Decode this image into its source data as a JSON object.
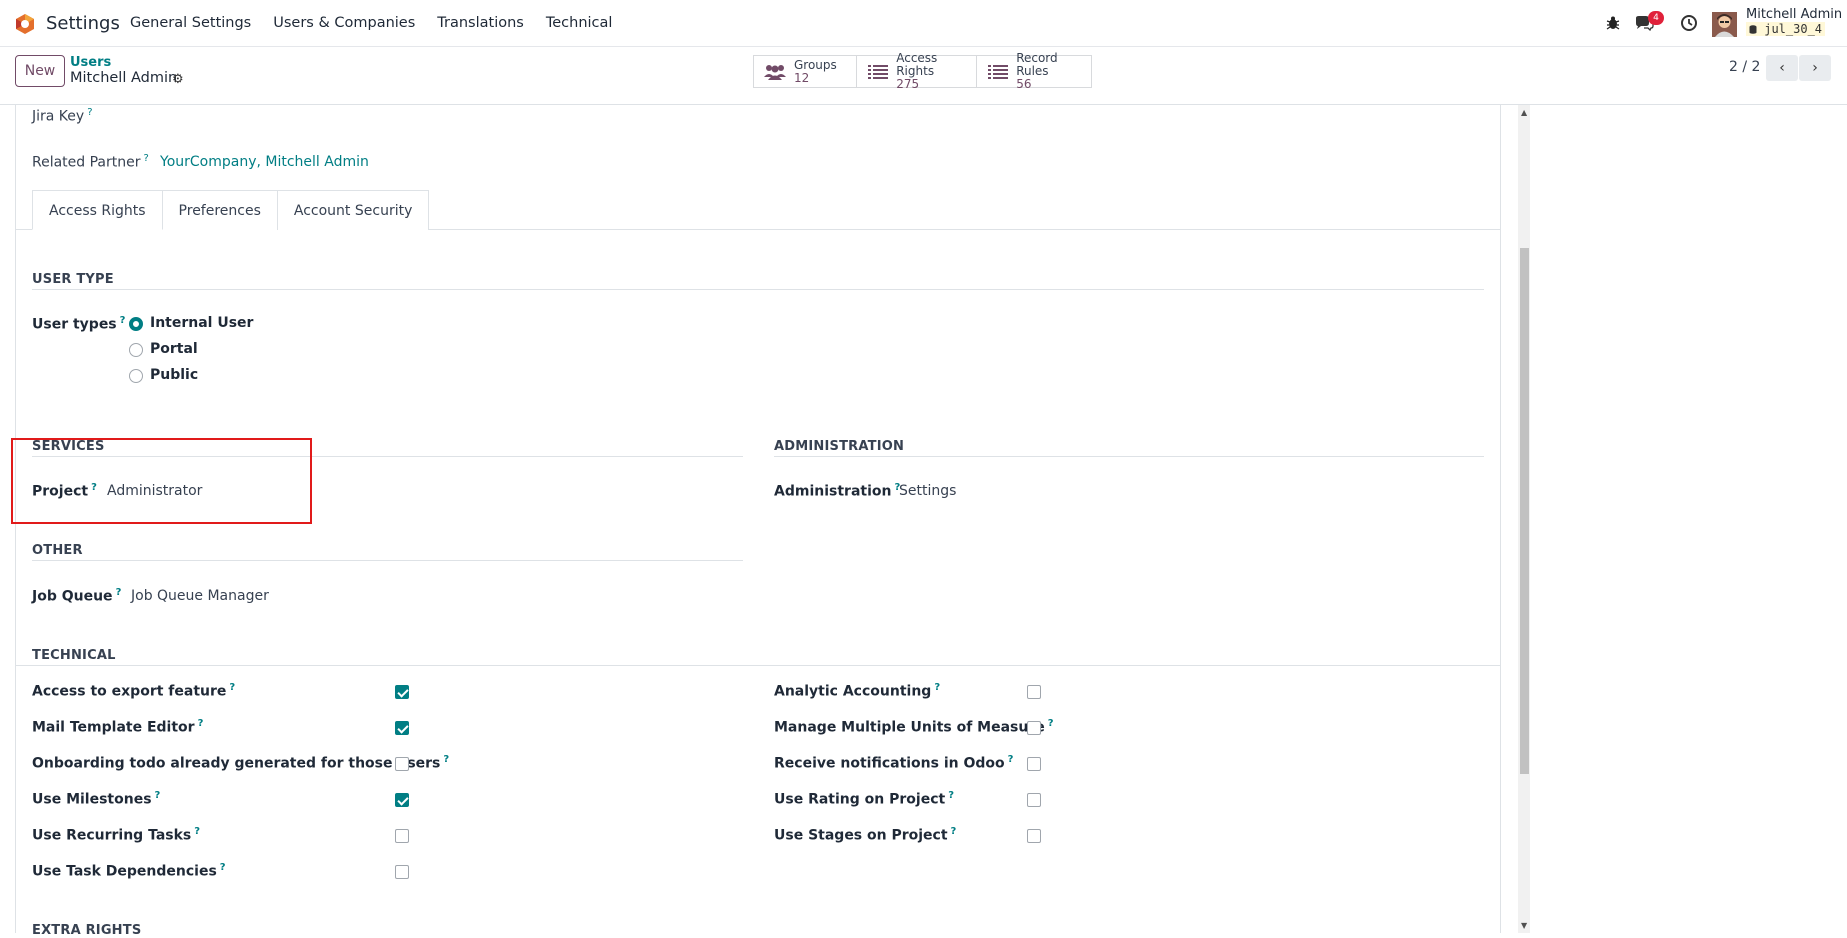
{
  "topbar": {
    "app_name": "Settings",
    "menu": [
      "General Settings",
      "Users & Companies",
      "Translations",
      "Technical"
    ],
    "messages_count": "4",
    "user_name": "Mitchell Admin",
    "database": "jul_30_4"
  },
  "control": {
    "new_label": "New",
    "breadcrumb_parent": "Users",
    "record_title": "Mitchell Admin",
    "smart_buttons": [
      {
        "label": "Groups",
        "value": "12",
        "icon": "users-icon"
      },
      {
        "label": "Access Rights",
        "value": "275",
        "icon": "list-icon"
      },
      {
        "label": "Record Rules",
        "value": "56",
        "icon": "list-icon"
      }
    ],
    "pager": "2 / 2"
  },
  "form": {
    "jira_key_label": "Jira Key",
    "related_partner_label": "Related Partner",
    "related_partner_value": "YourCompany, Mitchell Admin",
    "help_mark": "?",
    "tabs": [
      "Access Rights",
      "Preferences",
      "Account Security"
    ],
    "user_type": {
      "title": "USER TYPE",
      "label": "User types",
      "options": [
        "Internal User",
        "Portal",
        "Public"
      ],
      "selected": "Internal User"
    },
    "services": {
      "title": "SERVICES",
      "project_label": "Project",
      "project_value": "Administrator"
    },
    "administration": {
      "title": "ADMINISTRATION",
      "label": "Administration",
      "value": "Settings"
    },
    "other": {
      "title": "OTHER",
      "job_queue_label": "Job Queue",
      "job_queue_value": "Job Queue Manager"
    },
    "technical": {
      "title": "TECHNICAL",
      "left": [
        {
          "label": "Access to export feature",
          "checked": true
        },
        {
          "label": "Mail Template Editor",
          "checked": true
        },
        {
          "label": "Onboarding todo already generated for those users",
          "checked": false
        },
        {
          "label": "Use Milestones",
          "checked": true
        },
        {
          "label": "Use Recurring Tasks",
          "checked": false
        },
        {
          "label": "Use Task Dependencies",
          "checked": false
        }
      ],
      "right": [
        {
          "label": "Analytic Accounting",
          "checked": false
        },
        {
          "label": "Manage Multiple Units of Measure",
          "checked": false
        },
        {
          "label": "Receive notifications in Odoo",
          "checked": false
        },
        {
          "label": "Use Rating on Project",
          "checked": false
        },
        {
          "label": "Use Stages on Project",
          "checked": false
        }
      ]
    },
    "extra_rights_title": "EXTRA RIGHTS"
  },
  "colors": {
    "brand": "#714b67",
    "accent": "#017e84",
    "highlight_box": "#e11a1a"
  }
}
